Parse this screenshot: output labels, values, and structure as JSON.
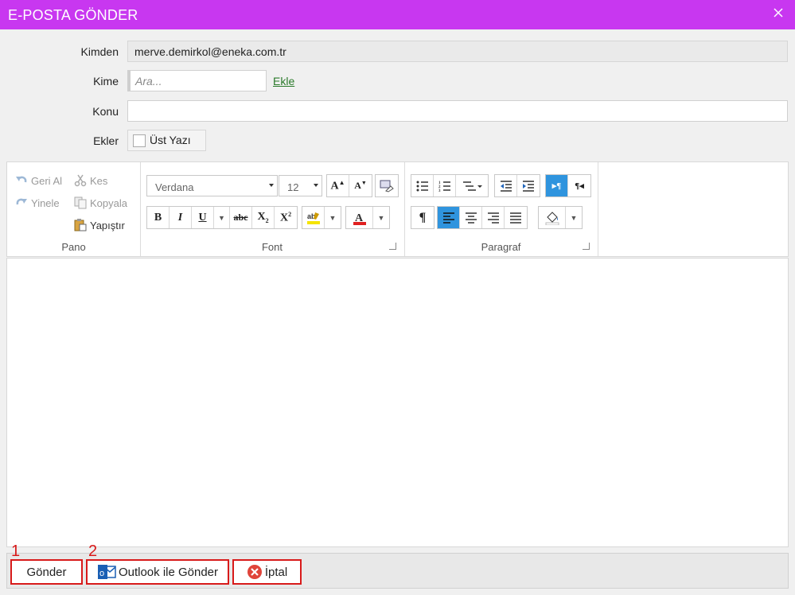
{
  "window": {
    "title": "E-POSTA GÖNDER"
  },
  "form": {
    "from_label": "Kimden",
    "from_value": "merve.demirkol@eneka.com.tr",
    "to_label": "Kime",
    "to_placeholder": "Ara...",
    "add_link": "Ekle",
    "subject_label": "Konu",
    "subject_value": "",
    "attachments_label": "Ekler",
    "cover_letter_label": "Üst Yazı"
  },
  "ribbon": {
    "clipboard": {
      "name": "Pano",
      "undo": "Geri Al",
      "redo": "Yinele",
      "cut": "Kes",
      "copy": "Kopyala",
      "paste": "Yapıştır"
    },
    "font": {
      "name": "Font",
      "family": "Verdana",
      "size": "12"
    },
    "paragraph": {
      "name": "Paragraf"
    }
  },
  "footer": {
    "send_label": "Gönder",
    "outlook_label": "Outlook ile Gönder",
    "cancel_label": "İptal",
    "marker_1": "1",
    "marker_2": "2"
  },
  "colors": {
    "title_bar": "#c837f0",
    "highlight_border": "#d81a1a",
    "active_button": "#2f94de"
  }
}
